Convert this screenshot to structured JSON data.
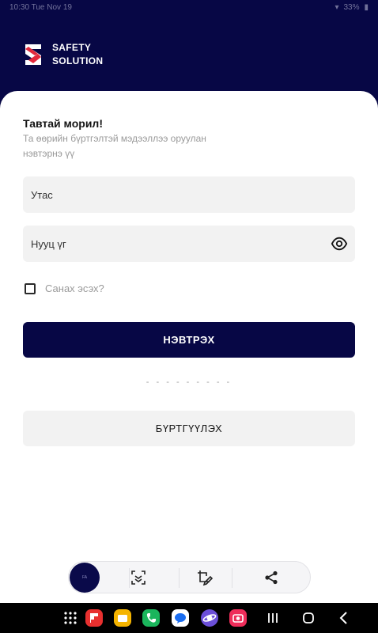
{
  "status_bar": {
    "left_text": "10:30 Tue Nov 19",
    "right_text": "33%"
  },
  "header": {
    "logo_line1": "SAFETY",
    "logo_line2": "SOLUTION",
    "background_color": "#070745",
    "logo_red": "#e3283c"
  },
  "login": {
    "welcome": "Тавтай морил!",
    "subtitle": "Та өөрийн бүртгэлтэй мэдээллээ оруулан нэвтэрнэ үү",
    "phone_placeholder": "Утас",
    "password_placeholder": "Нууц үг",
    "remember_label": "Санах эсэх?",
    "login_button": "НЭВТРЭХ",
    "divider": "- - - - - - - - -",
    "register_button": "БҮРТГҮҮЛЭХ"
  },
  "toolbar": {
    "avatar_text": "FA",
    "icons": [
      "scan-icon",
      "edit-crop-icon",
      "share-icon"
    ]
  },
  "nav": {
    "apps": [
      "apps-grid-icon",
      "flipboard-app-icon",
      "files-app-icon",
      "phone-app-icon",
      "messages-app-icon",
      "internet-app-icon",
      "camera-app-icon"
    ],
    "buttons": [
      "recents-button",
      "home-button",
      "back-button"
    ]
  }
}
